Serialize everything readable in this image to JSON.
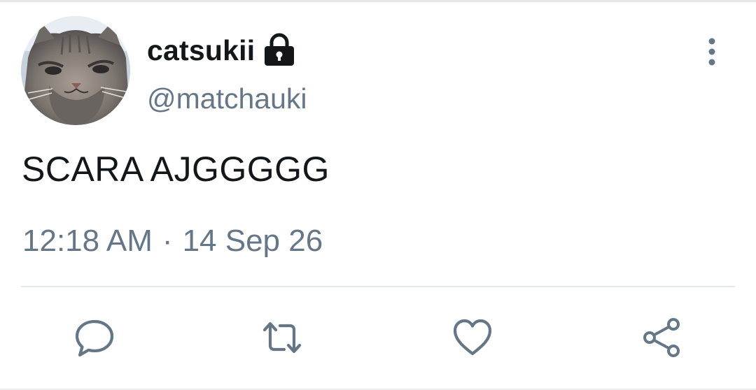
{
  "tweet": {
    "author": {
      "display_name": "catsukii",
      "handle": "@matchauki",
      "avatar_icon": "cat-avatar",
      "protected_icon": "lock-icon"
    },
    "text": "SCARA AJGGGGG",
    "timestamp": {
      "time": "12:18 AM",
      "separator": "·",
      "date": "14 Sep 26"
    }
  },
  "actions": [
    {
      "name": "reply",
      "icon": "comment-icon"
    },
    {
      "name": "retweet",
      "icon": "retweet-icon"
    },
    {
      "name": "like",
      "icon": "heart-icon"
    },
    {
      "name": "share",
      "icon": "share-icon"
    }
  ],
  "menu": {
    "icon": "more-vertical-icon"
  },
  "colors": {
    "primary_text": "#14171a",
    "secondary_text": "#657786",
    "divider": "#e1e8ed",
    "icon": "#657786"
  }
}
